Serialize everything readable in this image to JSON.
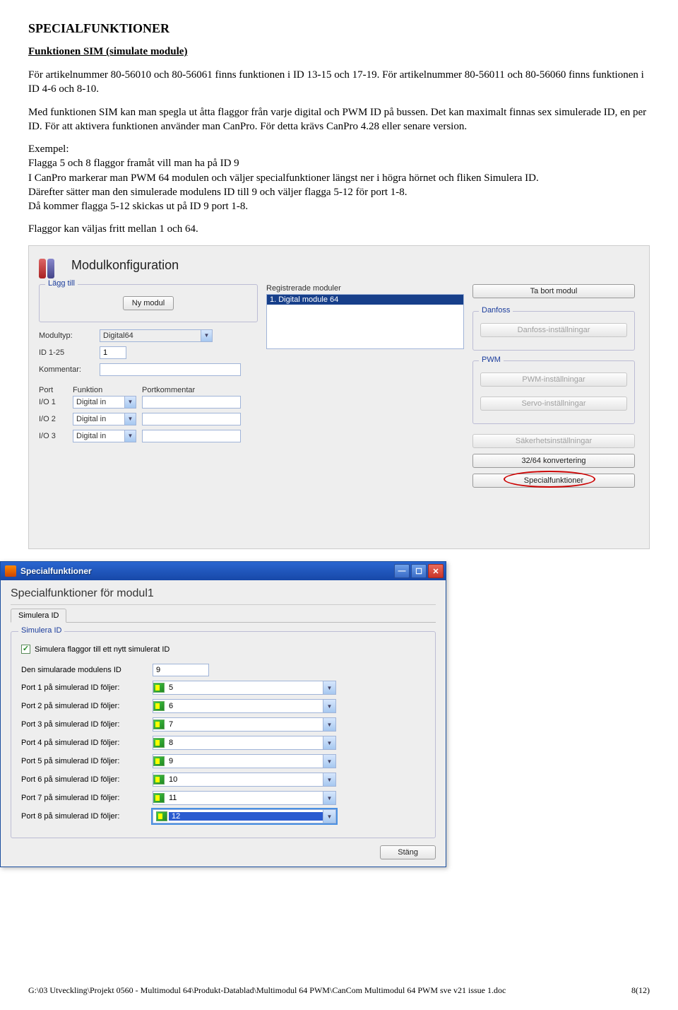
{
  "doc": {
    "h1": "SPECIALFUNKTIONER",
    "h2": "Funktionen SIM (simulate module)",
    "p1": "För artikelnummer 80-56010 och 80-56061 finns funktionen i ID 13-15 och 17-19. För artikelnummer 80-56011 och 80-56060 finns funktionen i ID 4-6 och 8-10.",
    "p2": "Med funktionen SIM kan man spegla ut åtta flaggor från varje digital och PWM ID på bussen. Det kan maximalt finnas sex simulerade ID, en per ID. För att aktivera funktionen använder man CanPro. För detta krävs CanPro 4.28 eller senare version.",
    "p3a": "Exempel:",
    "p3b": " Flagga 5 och 8 flaggor framåt vill man ha på ID 9",
    "p3c": "I CanPro markerar man PWM 64 modulen och väljer specialfunktioner längst ner i högra hörnet och fliken Simulera ID.",
    "p3d": "Därefter sätter man den simulerade modulens ID till 9 och väljer flagga 5-12 för port 1-8.",
    "p3e": "Då kommer flagga 5-12 skickas ut på ID 9 port 1-8.",
    "p4": "Flaggor kan väljas fritt mellan 1 och 64."
  },
  "main": {
    "title": "Modulkonfiguration",
    "grp_add": "Lägg till",
    "btn_new": "Ny modul",
    "lbl_modultyp": "Modultyp:",
    "val_modultyp": "Digital64",
    "lbl_id": "ID  1-25",
    "val_id": "1",
    "lbl_kommentar": "Kommentar:",
    "hdr_port": "Port",
    "hdr_funktion": "Funktion",
    "hdr_pkomm": "Portkommentar",
    "ports": [
      {
        "port": "I/O 1",
        "func": "Digital in"
      },
      {
        "port": "I/O 2",
        "func": "Digital in"
      },
      {
        "port": "I/O 3",
        "func": "Digital in"
      }
    ],
    "grp_reg": "Registrerade moduler",
    "reg_item": "1. Digital module 64",
    "btn_remove": "Ta bort modul",
    "grp_danfoss": "Danfoss",
    "btn_danfoss": "Danfoss-inställningar",
    "grp_pwm": "PWM",
    "btn_pwm": "PWM-inställningar",
    "btn_servo": "Servo-inställningar",
    "btn_safety": "Säkerhetsinställningar",
    "btn_conv": "32/64 konvertering",
    "btn_special": "Specialfunktioner"
  },
  "dlg": {
    "title": "Specialfunktioner",
    "h2": "Specialfunktioner för modul1",
    "tab": "Simulera ID",
    "grp": "Simulera ID",
    "cb": "Simulera flaggor till ett nytt simulerat ID",
    "lbl_id": "Den simularade modulens ID",
    "val_id": "9",
    "rows": [
      {
        "lbl": "Port 1 på simulerad ID följer:",
        "val": "5"
      },
      {
        "lbl": "Port 2 på simulerad ID följer:",
        "val": "6"
      },
      {
        "lbl": "Port 3 på simulerad ID följer:",
        "val": "7"
      },
      {
        "lbl": "Port 4 på simulerad ID följer:",
        "val": "8"
      },
      {
        "lbl": "Port 5 på simulerad ID följer:",
        "val": "9"
      },
      {
        "lbl": "Port 6 på simulerad ID följer:",
        "val": "10"
      },
      {
        "lbl": "Port 7 på simulerad ID följer:",
        "val": "11"
      },
      {
        "lbl": "Port 8 på simulerad ID följer:",
        "val": "12"
      }
    ],
    "btn_close": "Stäng"
  },
  "footer": {
    "path": "G:\\03 Utveckling\\Projekt 0560 - Multimodul 64\\Produkt-Datablad\\Multimodul 64 PWM\\CanCom Multimodul 64 PWM sve v21 issue 1.doc",
    "page": "8(12)"
  }
}
